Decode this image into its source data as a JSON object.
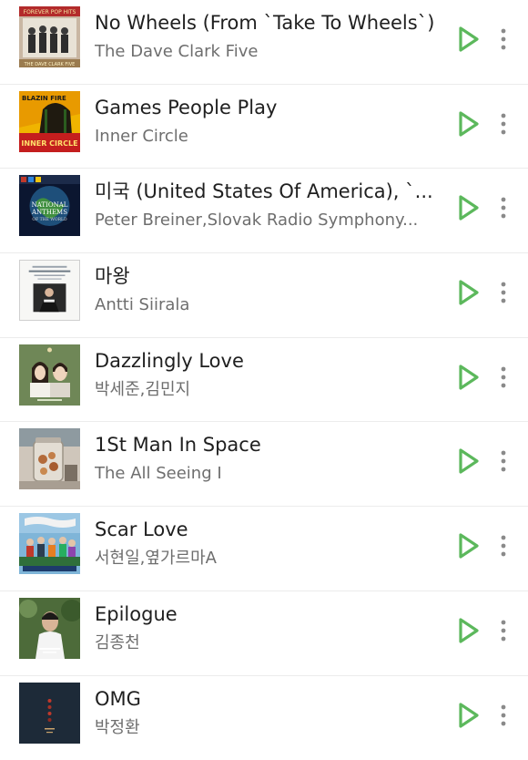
{
  "colors": {
    "accent": "#5cb85c",
    "title_text": "#1f1f1f",
    "artist_text": "#6e6e6e",
    "divider": "#ececec",
    "menu_dots": "#8a8a8a"
  },
  "tracks": [
    {
      "title": "No Wheels (From `Take To Wheels`)",
      "artist": "The Dave Clark Five",
      "art_banner_text": "FOREVER POP HITS",
      "art_footer_text": "THE DAVE CLARK FIVE"
    },
    {
      "title": "Games People Play",
      "artist": "Inner Circle",
      "art_top_text": "BLAZIN FIRE",
      "art_bottom_text": "INNER CIRCLE"
    },
    {
      "title": "미국 (United States Of America), `...",
      "artist": "Peter Breiner,Slovak Radio Symphony...",
      "art_text_1": "NATIONAL",
      "art_text_2": "ANTHEMS",
      "art_text_3": "OF THE WORLD"
    },
    {
      "title": "마왕",
      "artist": "Antti Siirala"
    },
    {
      "title": "Dazzlingly Love",
      "artist": "박세준,김민지"
    },
    {
      "title": "1St Man In Space",
      "artist": "The All Seeing I"
    },
    {
      "title": "Scar Love",
      "artist": "서현일,옆가르마A"
    },
    {
      "title": "Epilogue",
      "artist": "김종천"
    },
    {
      "title": "OMG",
      "artist": "박정환"
    }
  ]
}
